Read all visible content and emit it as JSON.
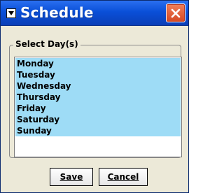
{
  "window": {
    "title": "Schedule",
    "close_icon": "close-icon"
  },
  "group": {
    "label": "Select Day(s)"
  },
  "days": [
    {
      "label": "Monday",
      "selected": true
    },
    {
      "label": "Tuesday",
      "selected": true
    },
    {
      "label": "Wednesday",
      "selected": true
    },
    {
      "label": "Thursday",
      "selected": true
    },
    {
      "label": "Friday",
      "selected": true
    },
    {
      "label": "Saturday",
      "selected": true
    },
    {
      "label": "Sunday",
      "selected": true
    }
  ],
  "buttons": {
    "save_label": "Save",
    "cancel_label": "Cancel"
  },
  "colors": {
    "titlebar": "#0a4fd8",
    "selection": "#9edcf6",
    "close_button": "#e4582f",
    "window_background": "#ece9d8"
  }
}
